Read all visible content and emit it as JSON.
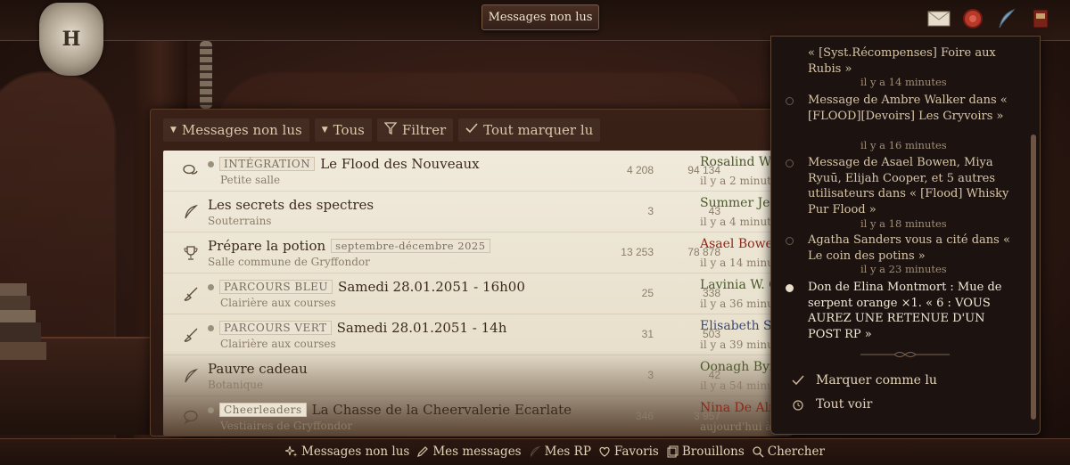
{
  "header": {
    "title": "Messages non lus",
    "icons": [
      "envelope-icon",
      "seal-icon",
      "quill-icon",
      "book-icon"
    ]
  },
  "filters": {
    "unread": "Messages non lus",
    "all": "Tous",
    "filter": "Filtrer",
    "mark_all": "Tout marquer lu"
  },
  "threads": [
    {
      "icon": "chat-bubbles-icon",
      "prefix": "INTÉGRATION",
      "title": "Le Flood des Nouveaux",
      "forum": "Petite salle",
      "replies": "4 208",
      "views": "94 134",
      "last_user": "Rosalind W",
      "last_color": "#4a5a2a",
      "ago": "il y a 2 minut"
    },
    {
      "icon": "feather-icon",
      "prefix": "",
      "title": "Les secrets des spectres",
      "forum": "Souterrains",
      "replies": "3",
      "views": "43",
      "last_user": "Summer Jen",
      "last_color": "#4a5a2a",
      "ago": "il y a 4 minut"
    },
    {
      "icon": "trophy-icon",
      "prefix": "",
      "title": "Prépare la potion",
      "tag": "septembre-décembre 2025",
      "forum": "Salle commune de Gryffondor",
      "replies": "13 253",
      "views": "78 878",
      "last_user": "Asael Bowen",
      "last_color": "#8a2a1a",
      "ago": "il y a 14 minut"
    },
    {
      "icon": "broom-icon",
      "prefix": "PARCOURS BLEU",
      "title": "Samedi 28.01.2051 - 16h00",
      "forum": "Clairière aux courses",
      "replies": "25",
      "views": "338",
      "last_user": "Lavinia W. C",
      "last_color": "#4a5a2a",
      "ago": "il y a 36 minut"
    },
    {
      "icon": "broom-icon",
      "prefix": "PARCOURS VERT",
      "title": "Samedi 28.01.2051 - 14h",
      "forum": "Clairière aux courses",
      "replies": "31",
      "views": "503",
      "last_user": "Elisabeth Sv",
      "last_color": "#3a4a7a",
      "ago": "il y a 39 minut"
    },
    {
      "icon": "feather-icon",
      "prefix": "",
      "title": "Pauvre cadeau",
      "forum": "Botanique",
      "replies": "3",
      "views": "42",
      "last_user": "Oonagh Byr",
      "last_color": "#4a5a2a",
      "ago": "il y a 54 minut"
    },
    {
      "icon": "speech-bubble-icon",
      "prefix": "Cheerleaders",
      "title": "La Chasse de la Cheervalerie Ecarlate",
      "forum": "Vestiaires de Gryffondor",
      "replies": "346",
      "views": "3 957",
      "last_user": "Nina De Aln",
      "last_color": "#8a2a1a",
      "ago": "aujourd'hui à"
    }
  ],
  "notifications": [
    {
      "text": "« [Syst.Récompenses] Foire aux Rubis »",
      "time": "il y a 14 minutes",
      "unread": false,
      "partial": true
    },
    {
      "text": "Message de Ambre Walker dans « [FLOOD][Devoirs] Les Gryvoirs »",
      "time": "il y a 16 minutes",
      "unread": false
    },
    {
      "text": "Message de Asael Bowen, Miya Ryuū, Elijah Cooper, et 5 autres utilisateurs dans « [Flood] Whisky Pur Flood »",
      "time": "il y a 18 minutes",
      "unread": false
    },
    {
      "text": "Agatha Sanders vous a cité dans « Le coin des potins »",
      "time": "il y a 23 minutes",
      "unread": false
    },
    {
      "text": "Don de Elina Montmort : Mue de serpent orange ×1. « 6 : VOUS AUREZ UNE RETENUE D'UN POST RP »",
      "time": "",
      "unread": true
    }
  ],
  "notif_actions": {
    "mark_read": "Marquer comme lu",
    "see_all": "Tout voir"
  },
  "bottom_nav": [
    {
      "icon": "sparkle-icon",
      "label": "Messages non lus"
    },
    {
      "icon": "pen-icon",
      "label": "Mes messages"
    },
    {
      "icon": "feather-icon",
      "label": "Mes RP"
    },
    {
      "icon": "heart-icon",
      "label": "Favoris"
    },
    {
      "icon": "drafts-icon",
      "label": "Brouillons"
    },
    {
      "icon": "search-icon",
      "label": "Chercher"
    }
  ]
}
